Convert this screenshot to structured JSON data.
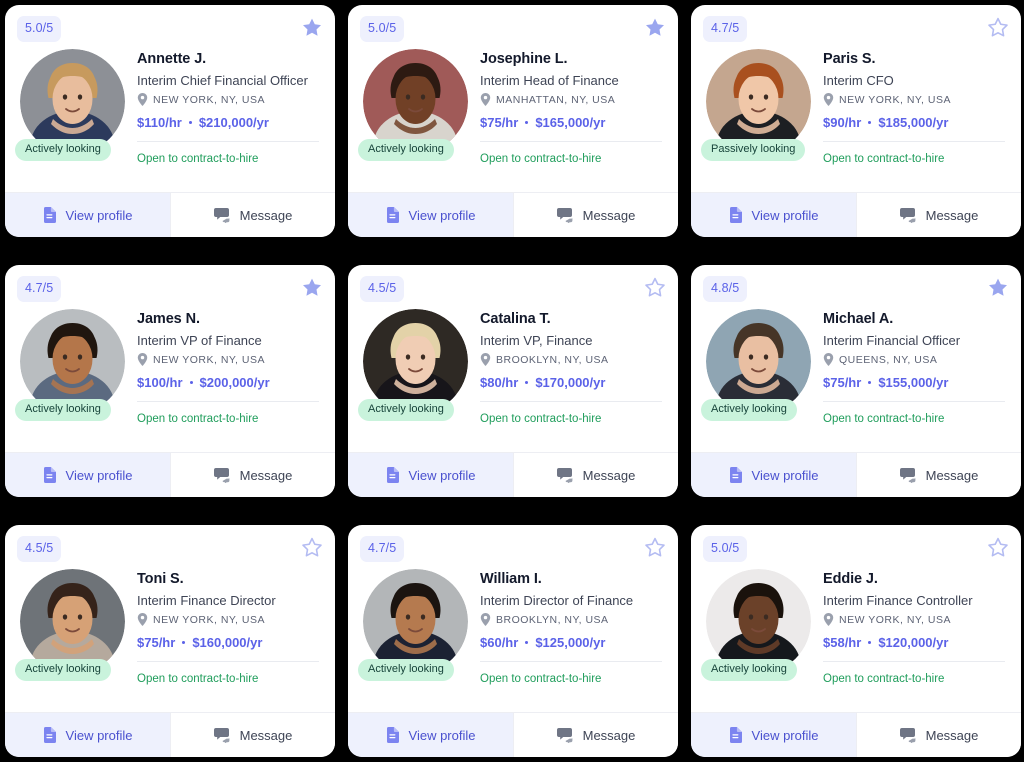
{
  "theme": {
    "page_background": "#000000",
    "card_background": "#ffffff",
    "accent": "#5b62e8",
    "rating_badge_bg": "#eef0fd",
    "status_pill_bg": "#c9f3dc",
    "openness_color": "#1f9d5b",
    "primary_button_bg": "#eef1fd"
  },
  "labels": {
    "view_profile": "View profile",
    "message": "Message",
    "rating_suffix": "/5"
  },
  "icons": {
    "favorite_filled": "star-filled-icon",
    "favorite_outline": "star-outline-icon",
    "location": "location-pin-icon",
    "view_profile": "document-icon",
    "message": "chat-bubbles-icon"
  },
  "candidates": [
    {
      "rating": "5.0/5",
      "favorited": true,
      "name": "Annette J.",
      "title": "Interim Chief Financial Officer",
      "location": "NEW YORK, NY, USA",
      "hourly_rate": "$110/hr",
      "yearly_rate": "$210,000/yr",
      "status": "Actively looking",
      "openness": "Open to contract-to-hire",
      "view_profile": "View profile",
      "message": "Message",
      "avatar": {
        "bg": "#8d9096",
        "skin": "#e8bd9d",
        "hair": "#c79a5e",
        "clothes": "#2c3a5c"
      }
    },
    {
      "rating": "5.0/5",
      "favorited": true,
      "name": "Josephine L.",
      "title": "Interim Head of Finance",
      "location": "MANHATTAN, NY, USA",
      "hourly_rate": "$75/hr",
      "yearly_rate": "$165,000/yr",
      "status": "Actively looking",
      "openness": "Open to contract-to-hire",
      "view_profile": "View profile",
      "message": "Message",
      "avatar": {
        "bg": "#a05a58",
        "skin": "#714026",
        "hair": "#2d1a12",
        "clothes": "#d8d4cd"
      }
    },
    {
      "rating": "4.7/5",
      "favorited": false,
      "name": "Paris S.",
      "title": "Interim CFO",
      "location": "NEW YORK, NY, USA",
      "hourly_rate": "$90/hr",
      "yearly_rate": "$185,000/yr",
      "status": "Passively looking",
      "openness": "Open to contract-to-hire",
      "view_profile": "View profile",
      "message": "Message",
      "avatar": {
        "bg": "#c4a68f",
        "skin": "#f0c7a8",
        "hair": "#a9501f",
        "clothes": "#1d1f23"
      }
    },
    {
      "rating": "4.7/5",
      "favorited": true,
      "name": "James N.",
      "title": "Interim VP of Finance",
      "location": "NEW YORK, NY, USA",
      "hourly_rate": "$100/hr",
      "yearly_rate": "$200,000/yr",
      "status": "Actively looking",
      "openness": "Open to contract-to-hire",
      "view_profile": "View profile",
      "message": "Message",
      "avatar": {
        "bg": "#b9bdc0",
        "skin": "#b4764a",
        "hair": "#20160f",
        "clothes": "#5b6a80"
      }
    },
    {
      "rating": "4.5/5",
      "favorited": false,
      "name": "Catalina T.",
      "title": "Interim VP, Finance",
      "location": "BROOKLYN, NY, USA",
      "hourly_rate": "$80/hr",
      "yearly_rate": "$170,000/yr",
      "status": "Actively looking",
      "openness": "Open to contract-to-hire",
      "view_profile": "View profile",
      "message": "Message",
      "avatar": {
        "bg": "#2e2924",
        "skin": "#f0cdb4",
        "hair": "#e3d2a8",
        "clothes": "#17151a"
      }
    },
    {
      "rating": "4.8/5",
      "favorited": true,
      "name": "Michael A.",
      "title": "Interim Financial Officer",
      "location": "QUEENS, NY, USA",
      "hourly_rate": "$75/hr",
      "yearly_rate": "$155,000/yr",
      "status": "Actively looking",
      "openness": "Open to contract-to-hire",
      "view_profile": "View profile",
      "message": "Message",
      "avatar": {
        "bg": "#8fa5b3",
        "skin": "#e9bfa2",
        "hair": "#463527",
        "clothes": "#2a2d36"
      }
    },
    {
      "rating": "4.5/5",
      "favorited": false,
      "name": "Toni S.",
      "title": "Interim Finance Director",
      "location": "NEW YORK, NY, USA",
      "hourly_rate": "$75/hr",
      "yearly_rate": "$160,000/yr",
      "status": "Actively looking",
      "openness": "Open to contract-to-hire",
      "view_profile": "View profile",
      "message": "Message",
      "avatar": {
        "bg": "#6e7378",
        "skin": "#d6a176",
        "hair": "#35231a",
        "clothes": "#b5a99d"
      }
    },
    {
      "rating": "4.7/5",
      "favorited": false,
      "name": "William I.",
      "title": "Interim Director of Finance",
      "location": "BROOKLYN, NY, USA",
      "hourly_rate": "$60/hr",
      "yearly_rate": "$125,000/yr",
      "status": "Actively looking",
      "openness": "Open to contract-to-hire",
      "view_profile": "View profile",
      "message": "Message",
      "avatar": {
        "bg": "#b3b6b8",
        "skin": "#b57a4f",
        "hair": "#1b1410",
        "clothes": "#1c2233"
      }
    },
    {
      "rating": "5.0/5",
      "favorited": false,
      "name": "Eddie J.",
      "title": "Interim Finance Controller",
      "location": "NEW YORK, NY, USA",
      "hourly_rate": "$58/hr",
      "yearly_rate": "$120,000/yr",
      "status": "Actively looking",
      "openness": "Open to contract-to-hire",
      "view_profile": "View profile",
      "message": "Message",
      "avatar": {
        "bg": "#eceaea",
        "skin": "#6b4129",
        "hair": "#1a120c",
        "clothes": "#15181c"
      }
    }
  ]
}
